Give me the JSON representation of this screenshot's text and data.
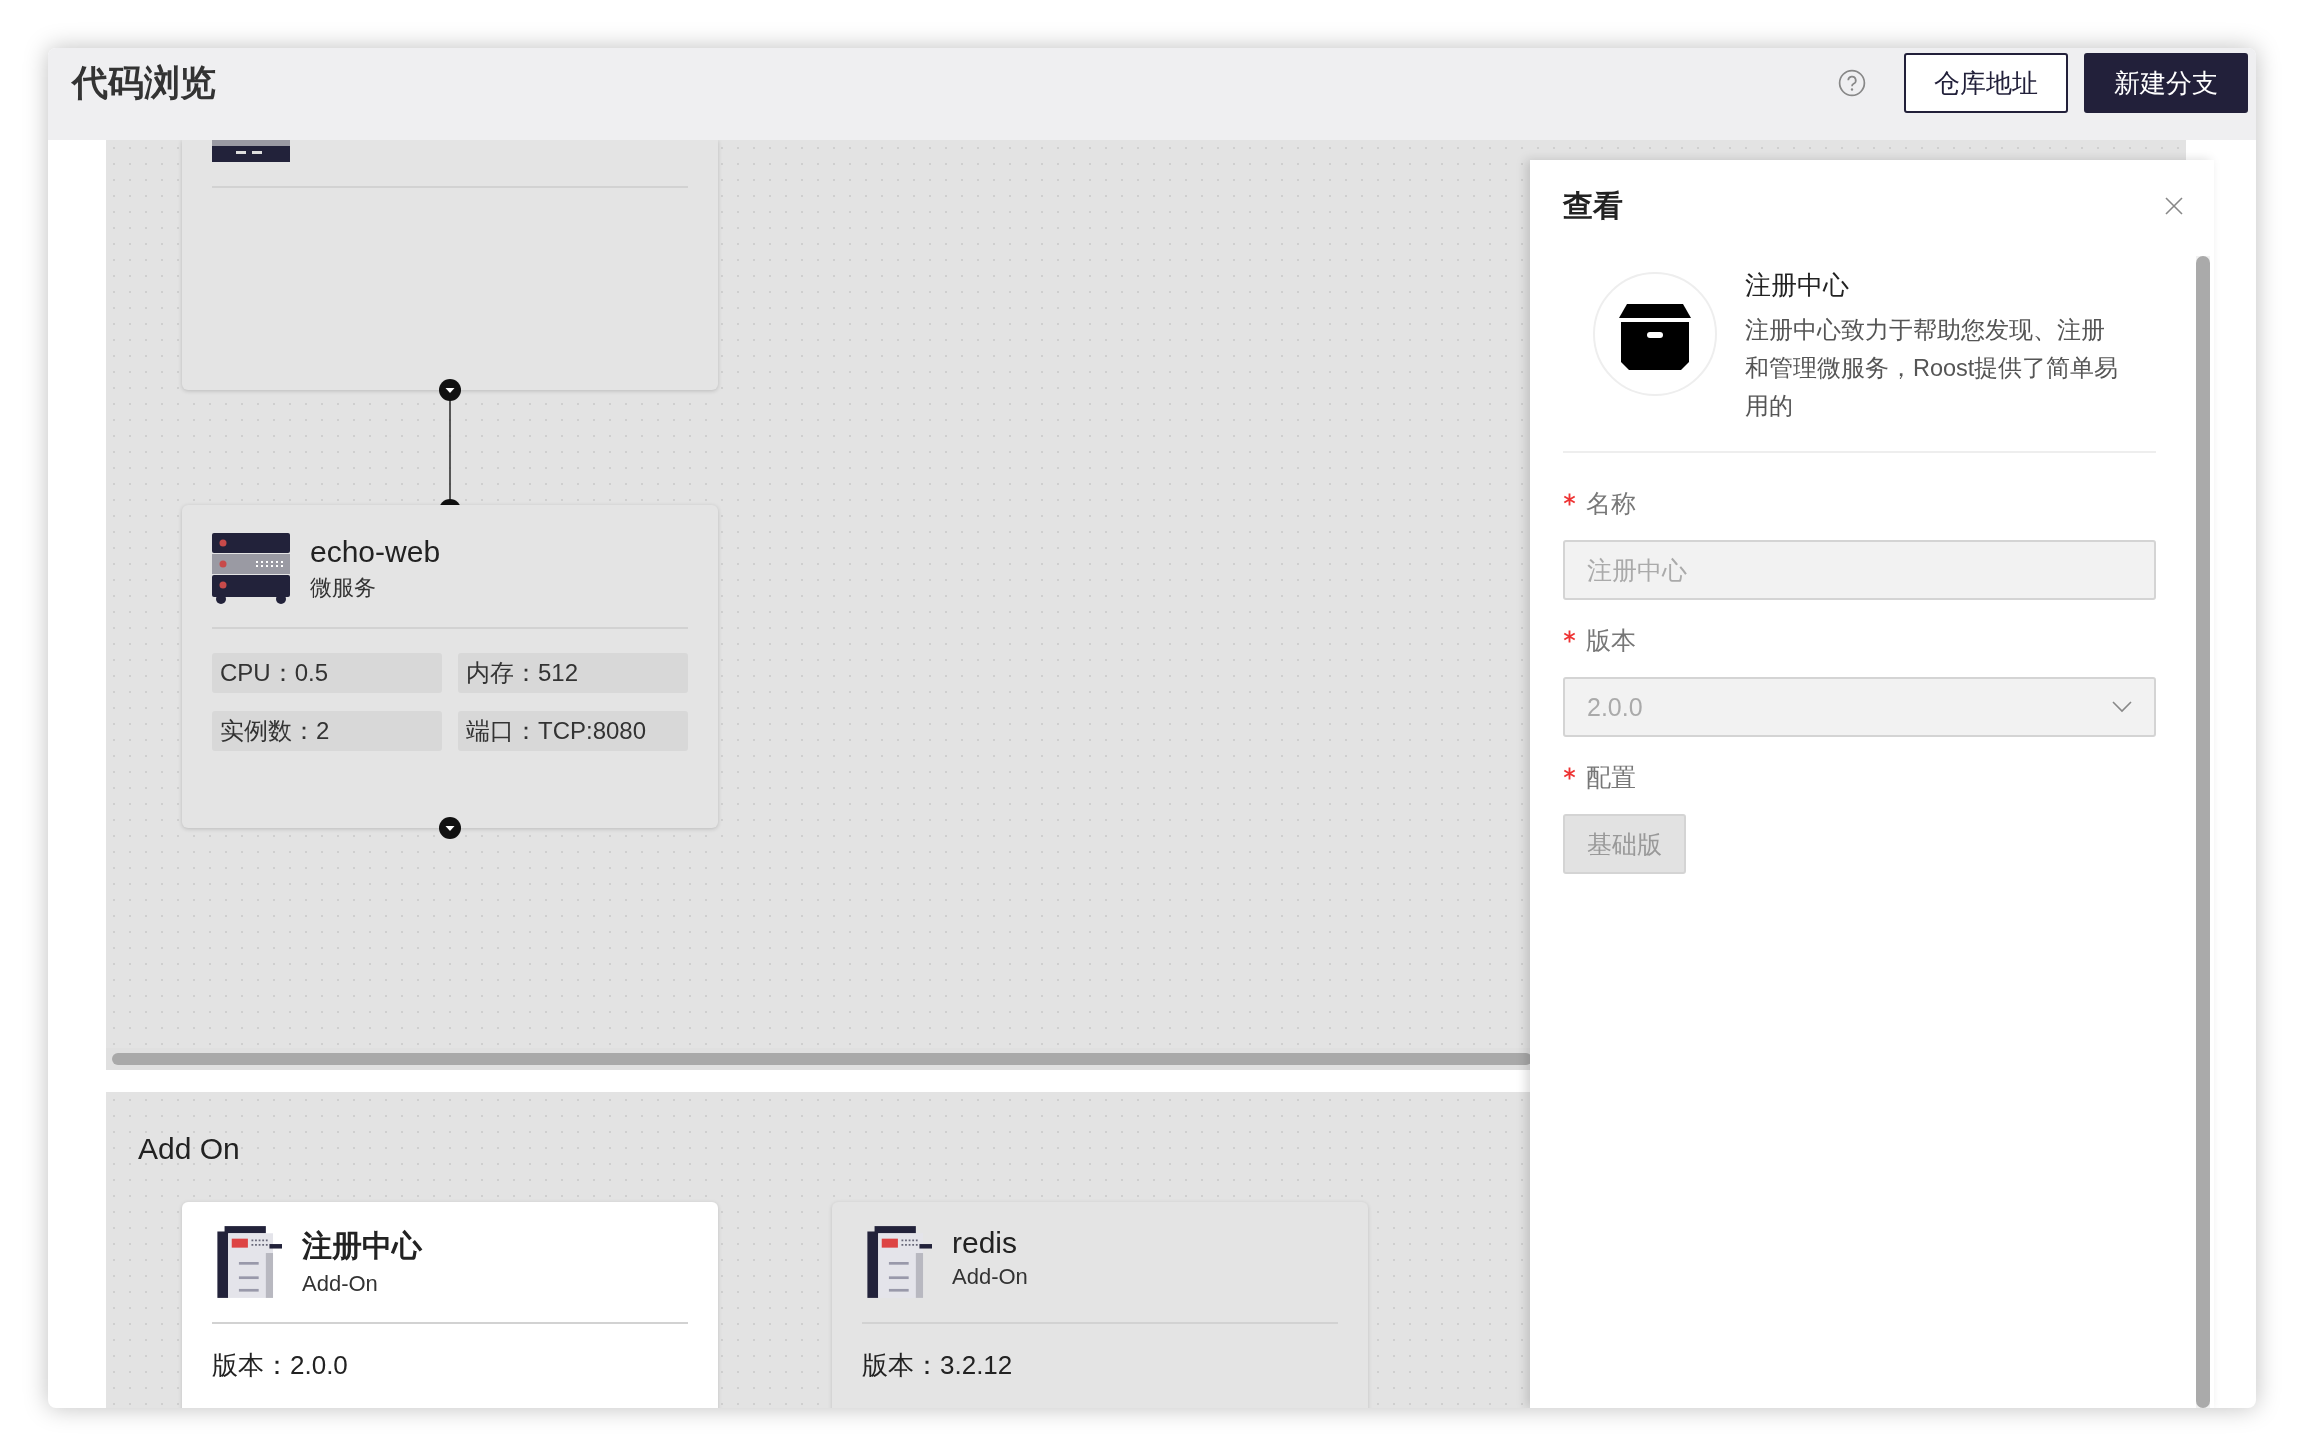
{
  "header": {
    "title": "代码浏览",
    "buttons": [
      {
        "label": "仓库地址",
        "kind": "outline"
      },
      {
        "label": "新建分支",
        "kind": "primary"
      }
    ]
  },
  "canvas": {
    "nodes": [
      {
        "kind": "partial"
      },
      {
        "kind": "service",
        "name": "echo-web",
        "type": "微服务",
        "specs": [
          "CPU：0.5",
          "内存：512",
          "实例数：2",
          "端口：TCP:8080"
        ]
      }
    ]
  },
  "addons": {
    "title": "Add On",
    "cards": [
      {
        "name": "注册中心",
        "type": "Add-On",
        "version": "版本：2.0.0",
        "selected": true
      },
      {
        "name": "redis",
        "type": "Add-On",
        "version": "版本：3.2.12",
        "selected": false
      }
    ]
  },
  "drawer": {
    "title": "查看",
    "app": {
      "name": "注册中心",
      "description": "注册中心致力于帮助您发现、注册和管理微服务，Roost提供了简单易用的"
    },
    "fields": [
      {
        "label": "名称",
        "required": true,
        "kind": "input",
        "value": "注册中心",
        "disabled": true
      },
      {
        "label": "版本",
        "required": true,
        "kind": "select",
        "value": "2.0.0",
        "disabled": true
      },
      {
        "label": "配置",
        "required": true,
        "kind": "options",
        "options": [
          {
            "label": "基础版",
            "selected": true
          }
        ]
      }
    ]
  }
}
